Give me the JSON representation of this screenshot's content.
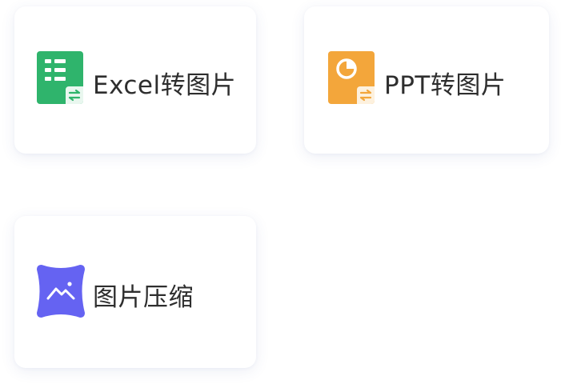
{
  "tools": [
    {
      "id": "excel-to-image",
      "label": "Excel转图片",
      "icon": "excel-convert-icon",
      "color": "#2fb46c"
    },
    {
      "id": "ppt-to-image",
      "label": "PPT转图片",
      "icon": "ppt-convert-icon",
      "color": "#f3a63b"
    },
    {
      "id": "image-compress",
      "label": "图片压缩",
      "icon": "image-compress-icon",
      "color": "#6563f2"
    }
  ]
}
